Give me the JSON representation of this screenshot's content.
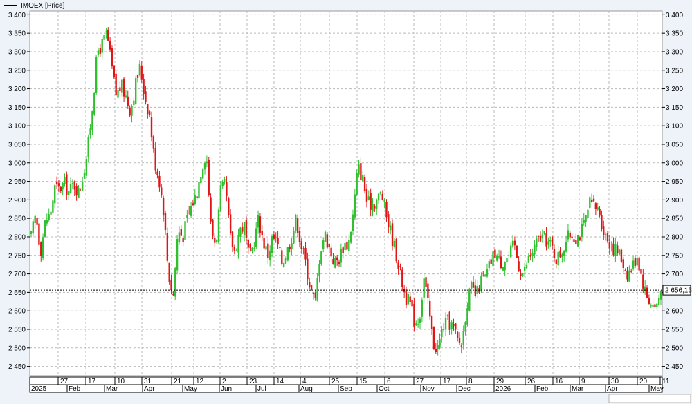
{
  "legend": {
    "label": "IMOEX [Price]"
  },
  "colors": {
    "up": "#2fbf2f",
    "down": "#e01616",
    "grid": "#b9b9b9",
    "background": "#ffffff",
    "frame": "#eef3fa"
  },
  "chart_data": {
    "type": "candlestick",
    "series_name": "IMOEX [Price]",
    "ylim": [
      2425,
      3410
    ],
    "y_ticks": [
      3400,
      3350,
      3300,
      3250,
      3200,
      3150,
      3100,
      3050,
      3000,
      2950,
      2900,
      2850,
      2800,
      2750,
      2700,
      2650,
      2600,
      2550,
      2500,
      2450
    ],
    "y_tick_labels": [
      "3 400",
      "3 350",
      "3 300",
      "3 250",
      "3 200",
      "3 150",
      "3 100",
      "3 050",
      "3 000",
      "2 950",
      "2 900",
      "2 850",
      "2 800",
      "2 750",
      "2 700",
      "2 650",
      "2 600",
      "2 550",
      "2 500",
      "2 450"
    ],
    "last_value": 2656.13,
    "last_value_label": "2 656,13",
    "x_axis_day_labels": [
      "27",
      "17",
      "10",
      "31",
      "21",
      "12",
      "2",
      "23",
      "14",
      "4",
      "25",
      "15",
      "6",
      "27",
      "17",
      "8",
      "29",
      "26",
      "16",
      "9",
      "30",
      "20",
      "11"
    ],
    "x_axis_month_labels": [
      "2025",
      "Feb",
      "Mar",
      "Apr",
      "May",
      "Jun",
      "Jul",
      "Aug",
      "Sep",
      "Oct",
      "Nov",
      "Dec",
      "2026",
      "Feb",
      "Mar",
      "Apr",
      "May"
    ],
    "close_path": [
      2800,
      2862,
      2760,
      2843,
      2860,
      2932,
      2930,
      2945,
      2920,
      2945,
      2920,
      2970,
      3040,
      3160,
      3300,
      3320,
      3350,
      3260,
      3180,
      3210,
      3180,
      3140,
      3210,
      3260,
      3180,
      3130,
      3010,
      2960,
      2870,
      2700,
      2640,
      2820,
      2800,
      2850,
      2890,
      2920,
      2990,
      3030,
      2820,
      2780,
      2920,
      2940,
      2800,
      2760,
      2820,
      2830,
      2740,
      2780,
      2850,
      2790,
      2750,
      2800,
      2780,
      2730,
      2760,
      2800,
      2850,
      2780,
      2730,
      2660,
      2620,
      2760,
      2810,
      2770,
      2730,
      2740,
      2780,
      2780,
      2860,
      2990,
      2960,
      2890,
      2890,
      2900,
      2920,
      2860,
      2810,
      2760,
      2700,
      2640,
      2620,
      2570,
      2580,
      2690,
      2600,
      2510,
      2500,
      2560,
      2570,
      2560,
      2520,
      2510,
      2620,
      2660,
      2640,
      2680,
      2690,
      2730,
      2760,
      2730,
      2740,
      2750,
      2780,
      2720,
      2700,
      2740,
      2760,
      2790,
      2800,
      2790,
      2770,
      2740,
      2760,
      2790,
      2810,
      2800,
      2810,
      2840,
      2890,
      2880,
      2870,
      2810,
      2790,
      2770,
      2760,
      2730,
      2700,
      2720,
      2750,
      2690,
      2640,
      2620,
      2610,
      2656
    ],
    "candles_count": 320
  }
}
